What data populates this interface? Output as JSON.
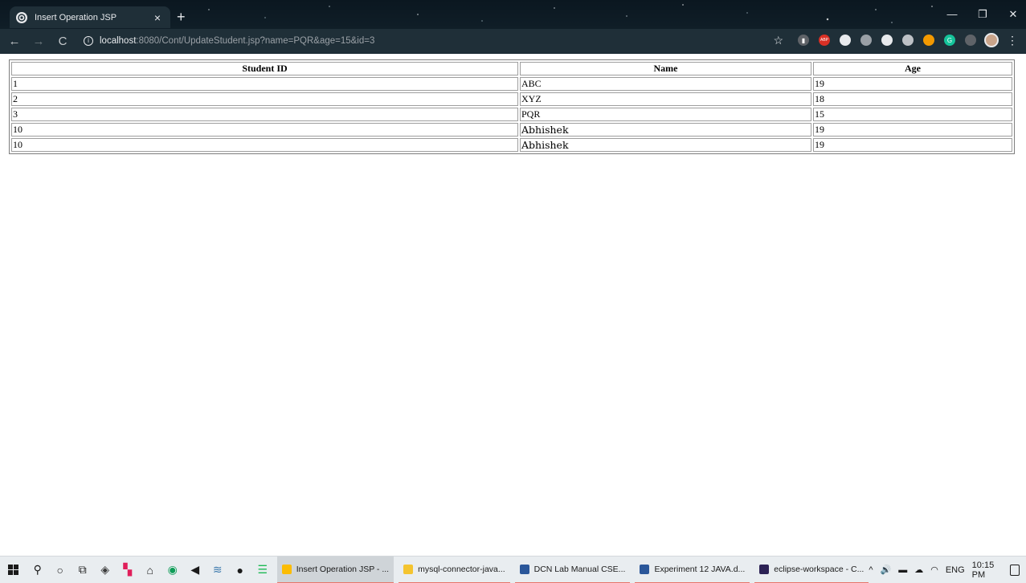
{
  "browser": {
    "tab_title": "Insert Operation JSP",
    "url_host": "localhost",
    "url_path": ":8080/Cont/UpdateStudent.jsp?name=PQR&age=15&id=3",
    "new_tab_label": "+",
    "close_label": "×",
    "minimize_label": "—",
    "restore_label": "❐",
    "window_close_label": "✕",
    "back_label": "←",
    "forward_label": "→",
    "reload_label": "C",
    "star_label": "☆",
    "menu_label": "⋮",
    "extensions": [
      {
        "name": "pages-icon",
        "color": "#5f6368",
        "glyph": "▮"
      },
      {
        "name": "adblock-icon",
        "color": "#d93025",
        "glyph": "ABP"
      },
      {
        "name": "speed-icon",
        "color": "#e8eaed",
        "glyph": ""
      },
      {
        "name": "puzzle-icon",
        "color": "#9aa0a6",
        "glyph": ""
      },
      {
        "name": "check-icon",
        "color": "#e8eaed",
        "glyph": ""
      },
      {
        "name": "circle-icon",
        "color": "#bdc1c6",
        "glyph": ""
      },
      {
        "name": "flame-icon",
        "color": "#f29900",
        "glyph": ""
      },
      {
        "name": "grammarly-icon",
        "color": "#15c39a",
        "glyph": "G"
      },
      {
        "name": "doc-icon",
        "color": "#5f6368",
        "glyph": ""
      }
    ]
  },
  "table": {
    "headers": [
      "Student ID",
      "Name",
      "Age"
    ],
    "rows": [
      {
        "id": "1",
        "name": "ABC",
        "age": "19"
      },
      {
        "id": "2",
        "name": "XYZ",
        "age": "18"
      },
      {
        "id": "3",
        "name": "PQR",
        "age": "15"
      },
      {
        "id": "10",
        "name": "Abhishek",
        "age": "19"
      },
      {
        "id": "10",
        "name": "Abhishek",
        "age": "19"
      }
    ]
  },
  "taskbar": {
    "pinned": [
      {
        "name": "search-icon",
        "glyph": "⚲"
      },
      {
        "name": "cortana-icon",
        "glyph": "○"
      },
      {
        "name": "task-view-icon",
        "glyph": "⧉"
      },
      {
        "name": "vscode-icon",
        "glyph": "◈",
        "color": "#3b3b3b"
      },
      {
        "name": "slack-icon",
        "glyph": "▚",
        "color": "#e01e5a"
      },
      {
        "name": "store-icon",
        "glyph": "⌂",
        "color": "#1a1a1a"
      },
      {
        "name": "maps-icon",
        "glyph": "◉",
        "color": "#0f9d58"
      },
      {
        "name": "media-icon",
        "glyph": "◀",
        "color": "#1a1a1a"
      },
      {
        "name": "python-icon",
        "glyph": "≋",
        "color": "#3776ab"
      },
      {
        "name": "obs-icon",
        "glyph": "●",
        "color": "#1a1a1a"
      },
      {
        "name": "spotify-icon",
        "glyph": "☰",
        "color": "#1db954"
      }
    ],
    "tasks": [
      {
        "name": "task-chrome",
        "label": "Insert Operation JSP - ...",
        "color": "#fbbc04",
        "active": true
      },
      {
        "name": "task-explorer",
        "label": "mysql-connector-java...",
        "color": "#f4c430",
        "active": false
      },
      {
        "name": "task-word-dcn",
        "label": "DCN Lab Manual CSE...",
        "color": "#2b579a",
        "active": false
      },
      {
        "name": "task-word-exp",
        "label": "Experiment 12 JAVA.d...",
        "color": "#2b579a",
        "active": false
      },
      {
        "name": "task-eclipse",
        "label": "eclipse-workspace - C...",
        "color": "#2c2255",
        "active": false
      }
    ],
    "tray": {
      "chevron": "^",
      "volume": "🔊",
      "battery": "▬",
      "cloud": "☁",
      "wifi": "◠",
      "language": "ENG",
      "time": "10:15 PM"
    }
  }
}
